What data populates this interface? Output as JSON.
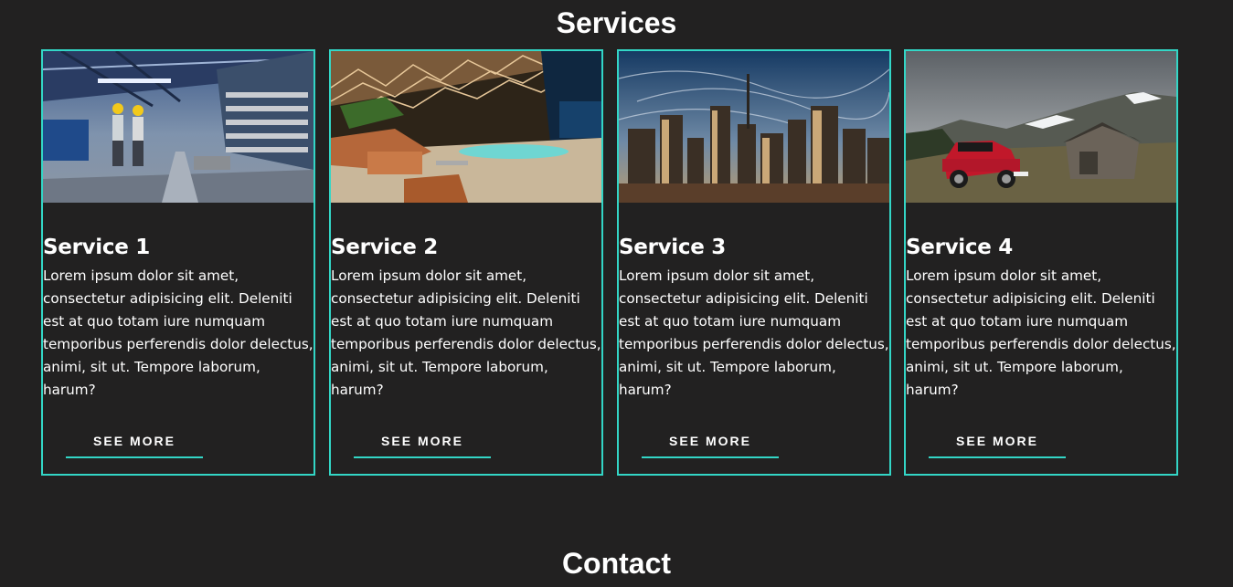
{
  "services": {
    "title": "Services",
    "cards": [
      {
        "title": "Service 1",
        "text": "Lorem ipsum dolor sit amet, consectetur adipisicing elit. Deleniti est at quo totam iure numquam temporibus perferendis dolor delectus, animi, sit ut. Tempore laborum, harum?",
        "button_label": "See more",
        "image": "industrial-warehouse-workers-photo"
      },
      {
        "title": "Service 2",
        "text": "Lorem ipsum dolor sit amet, consectetur adipisicing elit. Deleniti est at quo totam iure numquam temporibus perferendis dolor delectus, animi, sit ut. Tempore laborum, harum?",
        "button_label": "See more",
        "image": "modern-lounge-interior-photo"
      },
      {
        "title": "Service 3",
        "text": "Lorem ipsum dolor sit amet, consectetur adipisicing elit. Deleniti est at quo totam iure numquam temporibus perferendis dolor delectus, animi, sit ut. Tempore laborum, harum?",
        "button_label": "See more",
        "image": "city-skyline-photo"
      },
      {
        "title": "Service 4",
        "text": "Lorem ipsum dolor sit amet, consectetur adipisicing elit. Deleniti est at quo totam iure numquam temporibus perferendis dolor delectus, animi, sit ut. Tempore laborum, harum?",
        "button_label": "See more",
        "image": "red-car-mountains-photo"
      }
    ]
  },
  "contact": {
    "title": "Contact"
  },
  "colors": {
    "background": "#222121",
    "accent": "#33d6c6",
    "text": "#ffffff"
  }
}
